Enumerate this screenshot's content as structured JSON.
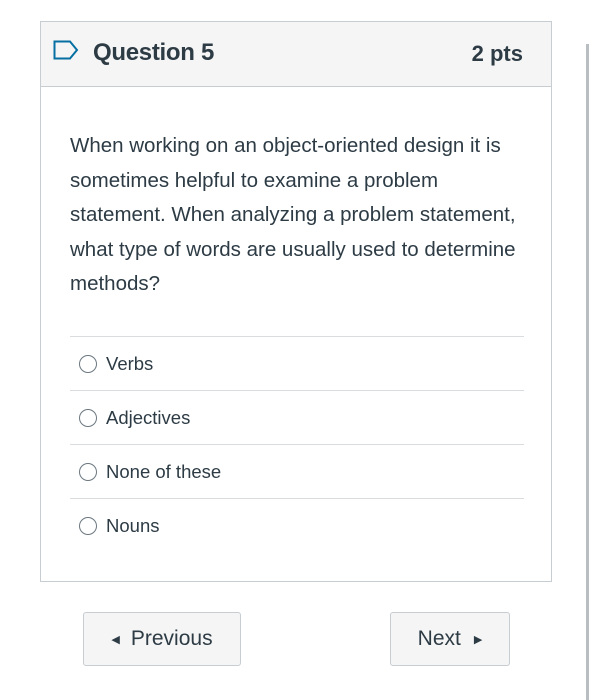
{
  "question": {
    "title": "Question 5",
    "points": "2 pts",
    "flag_icon": "flag-outline-icon",
    "text": "When working on an object-oriented design it is sometimes helpful to examine a problem statement.  When analyzing a problem statement, what type of words are usually used to determine methods?"
  },
  "answers": [
    {
      "label": "Verbs",
      "selected": false
    },
    {
      "label": "Adjectives",
      "selected": false
    },
    {
      "label": "None of these",
      "selected": false
    },
    {
      "label": "Nouns",
      "selected": false
    }
  ],
  "navigation": {
    "previous_label": "Previous",
    "next_label": "Next",
    "previous_icon": "caret-left-icon",
    "next_icon": "caret-right-icon"
  },
  "colors": {
    "text": "#2d3b45",
    "border": "#c7cdd1",
    "header_bg": "#f5f5f5",
    "flag": "#0770a3"
  }
}
